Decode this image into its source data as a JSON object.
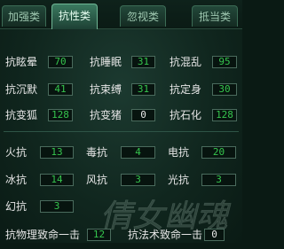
{
  "tabs": [
    {
      "label": "加强类",
      "active": false
    },
    {
      "label": "抗性类",
      "active": true
    },
    {
      "label": "忽视类",
      "active": false
    },
    {
      "label": "抵当类",
      "active": false
    }
  ],
  "resist_rows": [
    [
      {
        "label": "抗眩晕",
        "value": "70"
      },
      {
        "label": "抗睡眠",
        "value": "31"
      },
      {
        "label": "抗混乱",
        "value": "95"
      }
    ],
    [
      {
        "label": "抗沉默",
        "value": "41"
      },
      {
        "label": "抗束缚",
        "value": "31"
      },
      {
        "label": "抗定身",
        "value": "30"
      }
    ],
    [
      {
        "label": "抗变狐",
        "value": "128"
      },
      {
        "label": "抗变猪",
        "value": "0"
      },
      {
        "label": "抗石化",
        "value": "128"
      }
    ]
  ],
  "element_rows": [
    [
      {
        "label": "火抗",
        "value": "13"
      },
      {
        "label": "毒抗",
        "value": "4"
      },
      {
        "label": "电抗",
        "value": "20"
      }
    ],
    [
      {
        "label": "冰抗",
        "value": "14"
      },
      {
        "label": "风抗",
        "value": "3"
      },
      {
        "label": "光抗",
        "value": "3"
      }
    ],
    [
      {
        "label": "幻抗",
        "value": "3"
      }
    ]
  ],
  "fatal": [
    {
      "label": "抗物理致命一击",
      "value": "12"
    },
    {
      "label": "抗法术致命一击",
      "value": "0"
    }
  ],
  "watermark": "倩女幽魂",
  "colors": {
    "value_green": "#35c44d",
    "value_white": "#e8e8e8",
    "panel_bg": "#10261e",
    "tab_active": "#3b7a60"
  }
}
